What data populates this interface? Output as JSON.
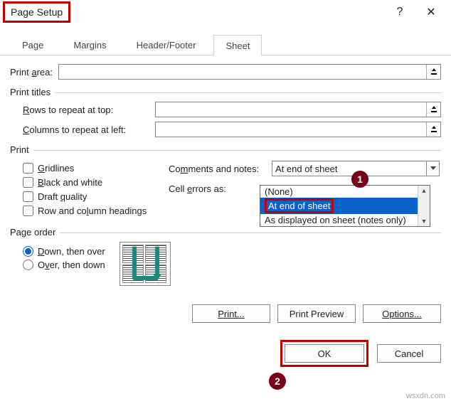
{
  "titlebar": {
    "title": "Page Setup",
    "help": "?",
    "close": "✕"
  },
  "tabs": {
    "page": "Page",
    "margins": "Margins",
    "headerfooter": "Header/Footer",
    "sheet": "Sheet"
  },
  "print_area": {
    "label_pre": "Print ",
    "label_u": "a",
    "label_post": "rea:",
    "value": ""
  },
  "print_titles": {
    "legend": "Print titles",
    "rows": {
      "u": "R",
      "post": "ows to repeat at top:",
      "value": ""
    },
    "cols": {
      "u": "C",
      "post": "olumns to repeat at left:",
      "value": ""
    }
  },
  "print_group": {
    "legend": "Print",
    "gridlines": {
      "u": "G",
      "post": "ridlines"
    },
    "bw": {
      "u": "B",
      "post": "lack and white"
    },
    "draft": {
      "pre": "Draft ",
      "u": "q",
      "post": "uality"
    },
    "headings": {
      "pre": "Row and co",
      "u": "l",
      "post": "umn headings"
    },
    "comments": {
      "pre": "Co",
      "u": "m",
      "post": "ments and notes:",
      "value": "At end of sheet"
    },
    "errors": {
      "pre": "Cell ",
      "u": "e",
      "post": "rrors as:"
    },
    "options": {
      "none": "(None)",
      "end": "At end of sheet",
      "disp": "As displayed on sheet (notes only)"
    }
  },
  "order": {
    "legend": "Page order",
    "down": {
      "u": "D",
      "post": "own, then over"
    },
    "over": {
      "pre": "O",
      "u": "v",
      "post": "er, then down"
    }
  },
  "buttons": {
    "print": "Print...",
    "preview": "Print Preview",
    "options": "Options...",
    "ok": "OK",
    "cancel": "Cancel"
  },
  "markers": {
    "one": "1",
    "two": "2"
  },
  "watermark": "wsxdn.com"
}
